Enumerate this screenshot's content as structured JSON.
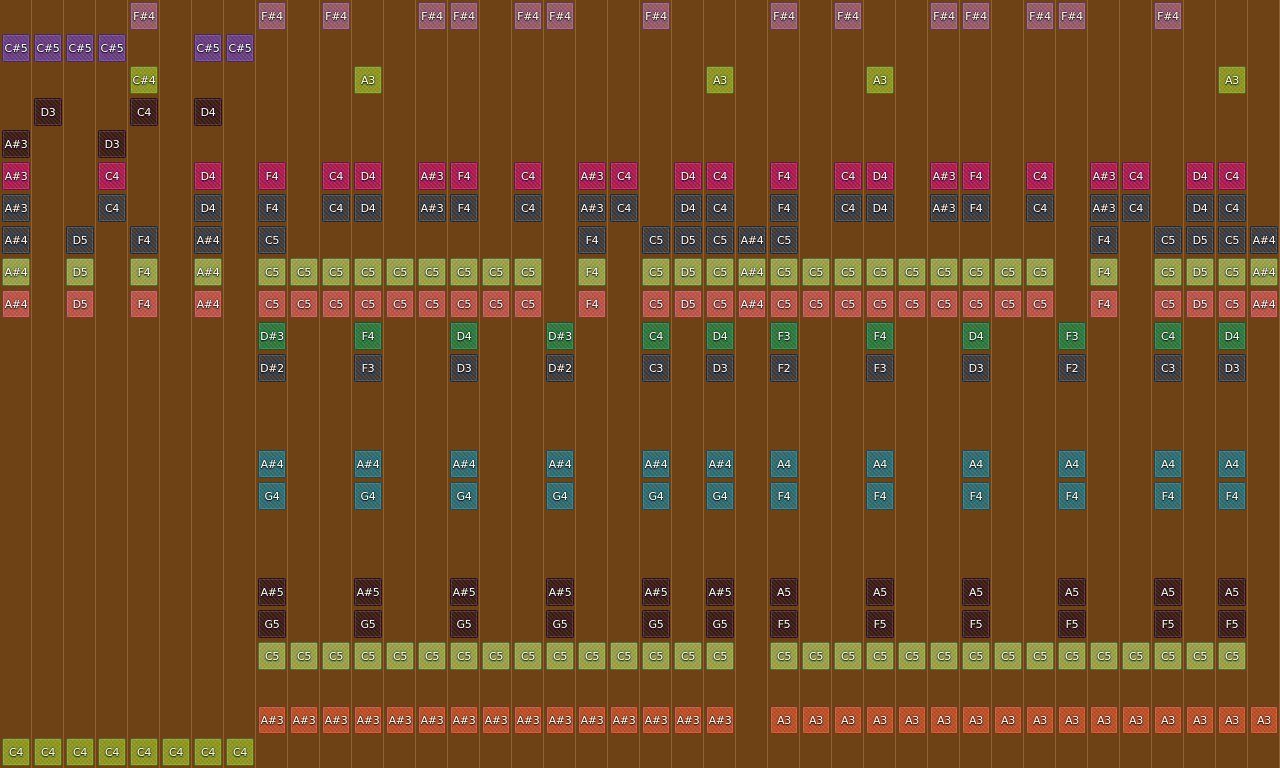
{
  "colors": {
    "background": "#6e4214",
    "pink": "#9a5a6a",
    "purple": "#6c3e86",
    "olive": "#8e9a1e",
    "darkbrown": "#3c1a16",
    "magenta": "#b01a52",
    "darkgray": "#3c3c3e",
    "lightgreen": "#9aa446",
    "salmon": "#c05446",
    "green": "#2c7a3c",
    "teal": "#2e6e72",
    "orange": "#c04e24"
  },
  "rows": [
    {
      "color": "pink",
      "notes": [
        [
          4,
          "F#4"
        ],
        [
          8,
          "F#4"
        ],
        [
          10,
          "F#4"
        ],
        [
          13,
          "F#4"
        ],
        [
          14,
          "F#4"
        ],
        [
          16,
          "F#4"
        ],
        [
          17,
          "F#4"
        ],
        [
          20,
          "F#4"
        ],
        [
          24,
          "F#4"
        ],
        [
          26,
          "F#4"
        ],
        [
          29,
          "F#4"
        ],
        [
          30,
          "F#4"
        ],
        [
          32,
          "F#4"
        ],
        [
          33,
          "F#4"
        ],
        [
          36,
          "F#4"
        ]
      ]
    },
    {
      "color": "purple",
      "notes": [
        [
          0,
          "C#5"
        ],
        [
          1,
          "C#5"
        ],
        [
          2,
          "C#5"
        ],
        [
          3,
          "C#5"
        ],
        [
          6,
          "C#5"
        ],
        [
          7,
          "C#5"
        ]
      ]
    },
    {
      "color": "olive",
      "notes": [
        [
          4,
          "C#4"
        ],
        [
          11,
          "A3"
        ],
        [
          22,
          "A3"
        ],
        [
          27,
          "A3"
        ],
        [
          38,
          "A3"
        ]
      ]
    },
    {
      "color": "darkbrown",
      "notes": [
        [
          1,
          "D3"
        ],
        [
          4,
          "C4"
        ],
        [
          6,
          "D4"
        ]
      ]
    },
    {
      "color": "darkbrown",
      "notes": [
        [
          0,
          "A#3"
        ],
        [
          3,
          "D3"
        ]
      ]
    },
    {
      "color": "magenta",
      "notes": [
        [
          0,
          "A#3"
        ],
        [
          3,
          "C4"
        ],
        [
          6,
          "D4"
        ],
        [
          8,
          "F4"
        ],
        [
          10,
          "C4"
        ],
        [
          11,
          "D4"
        ],
        [
          13,
          "A#3"
        ],
        [
          14,
          "F4"
        ],
        [
          16,
          "C4"
        ],
        [
          18,
          "A#3"
        ],
        [
          19,
          "C4"
        ],
        [
          21,
          "D4"
        ],
        [
          22,
          "C4"
        ],
        [
          24,
          "F4"
        ],
        [
          26,
          "C4"
        ],
        [
          27,
          "D4"
        ],
        [
          29,
          "A#3"
        ],
        [
          30,
          "F4"
        ],
        [
          32,
          "C4"
        ],
        [
          34,
          "A#3"
        ],
        [
          35,
          "C4"
        ],
        [
          37,
          "D4"
        ],
        [
          38,
          "C4"
        ]
      ]
    },
    {
      "color": "darkgray",
      "notes": [
        [
          0,
          "A#3"
        ],
        [
          3,
          "C4"
        ],
        [
          6,
          "D4"
        ],
        [
          8,
          "F4"
        ],
        [
          10,
          "C4"
        ],
        [
          11,
          "D4"
        ],
        [
          13,
          "A#3"
        ],
        [
          14,
          "F4"
        ],
        [
          16,
          "C4"
        ],
        [
          18,
          "A#3"
        ],
        [
          19,
          "C4"
        ],
        [
          21,
          "D4"
        ],
        [
          22,
          "C4"
        ],
        [
          24,
          "F4"
        ],
        [
          26,
          "C4"
        ],
        [
          27,
          "D4"
        ],
        [
          29,
          "A#3"
        ],
        [
          30,
          "F4"
        ],
        [
          32,
          "C4"
        ],
        [
          34,
          "A#3"
        ],
        [
          35,
          "C4"
        ],
        [
          37,
          "D4"
        ],
        [
          38,
          "C4"
        ]
      ]
    },
    {
      "color": "darkgray",
      "notes": [
        [
          0,
          "A#4"
        ],
        [
          2,
          "D5"
        ],
        [
          4,
          "F4"
        ],
        [
          6,
          "A#4"
        ],
        [
          8,
          "C5"
        ],
        [
          18,
          "F4"
        ],
        [
          20,
          "C5"
        ],
        [
          21,
          "D5"
        ],
        [
          22,
          "C5"
        ],
        [
          23,
          "A#4"
        ],
        [
          24,
          "C5"
        ],
        [
          34,
          "F4"
        ],
        [
          36,
          "C5"
        ],
        [
          37,
          "D5"
        ],
        [
          38,
          "C5"
        ],
        [
          39,
          "A#4"
        ]
      ]
    },
    {
      "color": "lightgreen",
      "notes": [
        [
          0,
          "A#4"
        ],
        [
          2,
          "D5"
        ],
        [
          4,
          "F4"
        ],
        [
          6,
          "A#4"
        ],
        [
          8,
          "C5"
        ],
        [
          9,
          "C5"
        ],
        [
          10,
          "C5"
        ],
        [
          11,
          "C5"
        ],
        [
          12,
          "C5"
        ],
        [
          13,
          "C5"
        ],
        [
          14,
          "C5"
        ],
        [
          15,
          "C5"
        ],
        [
          16,
          "C5"
        ],
        [
          18,
          "F4"
        ],
        [
          20,
          "C5"
        ],
        [
          21,
          "D5"
        ],
        [
          22,
          "C5"
        ],
        [
          23,
          "A#4"
        ],
        [
          24,
          "C5"
        ],
        [
          25,
          "C5"
        ],
        [
          26,
          "C5"
        ],
        [
          27,
          "C5"
        ],
        [
          28,
          "C5"
        ],
        [
          29,
          "C5"
        ],
        [
          30,
          "C5"
        ],
        [
          31,
          "C5"
        ],
        [
          32,
          "C5"
        ],
        [
          34,
          "F4"
        ],
        [
          36,
          "C5"
        ],
        [
          37,
          "D5"
        ],
        [
          38,
          "C5"
        ],
        [
          39,
          "A#4"
        ]
      ]
    },
    {
      "color": "salmon",
      "notes": [
        [
          0,
          "A#4"
        ],
        [
          2,
          "D5"
        ],
        [
          4,
          "F4"
        ],
        [
          6,
          "A#4"
        ],
        [
          8,
          "C5"
        ],
        [
          9,
          "C5"
        ],
        [
          10,
          "C5"
        ],
        [
          11,
          "C5"
        ],
        [
          12,
          "C5"
        ],
        [
          13,
          "C5"
        ],
        [
          14,
          "C5"
        ],
        [
          15,
          "C5"
        ],
        [
          16,
          "C5"
        ],
        [
          18,
          "F4"
        ],
        [
          20,
          "C5"
        ],
        [
          21,
          "D5"
        ],
        [
          22,
          "C5"
        ],
        [
          23,
          "A#4"
        ],
        [
          24,
          "C5"
        ],
        [
          25,
          "C5"
        ],
        [
          26,
          "C5"
        ],
        [
          27,
          "C5"
        ],
        [
          28,
          "C5"
        ],
        [
          29,
          "C5"
        ],
        [
          30,
          "C5"
        ],
        [
          31,
          "C5"
        ],
        [
          32,
          "C5"
        ],
        [
          34,
          "F4"
        ],
        [
          36,
          "C5"
        ],
        [
          37,
          "D5"
        ],
        [
          38,
          "C5"
        ],
        [
          39,
          "A#4"
        ]
      ]
    },
    {
      "color": "green",
      "notes": [
        [
          8,
          "D#3"
        ],
        [
          11,
          "F4"
        ],
        [
          14,
          "D4"
        ],
        [
          17,
          "D#3"
        ],
        [
          20,
          "C4"
        ],
        [
          22,
          "D4"
        ],
        [
          24,
          "F3"
        ],
        [
          27,
          "F4"
        ],
        [
          30,
          "D4"
        ],
        [
          33,
          "F3"
        ],
        [
          36,
          "C4"
        ],
        [
          38,
          "D4"
        ]
      ]
    },
    {
      "color": "darkgray",
      "notes": [
        [
          8,
          "D#2"
        ],
        [
          11,
          "F3"
        ],
        [
          14,
          "D3"
        ],
        [
          17,
          "D#2"
        ],
        [
          20,
          "C3"
        ],
        [
          22,
          "D3"
        ],
        [
          24,
          "F2"
        ],
        [
          27,
          "F3"
        ],
        [
          30,
          "D3"
        ],
        [
          33,
          "F2"
        ],
        [
          36,
          "C3"
        ],
        [
          38,
          "D3"
        ]
      ]
    },
    {
      "color": "teal",
      "notes": []
    },
    {
      "color": "teal",
      "notes": []
    },
    {
      "color": "teal",
      "notes": [
        [
          8,
          "A#4"
        ],
        [
          11,
          "A#4"
        ],
        [
          14,
          "A#4"
        ],
        [
          17,
          "A#4"
        ],
        [
          20,
          "A#4"
        ],
        [
          22,
          "A#4"
        ],
        [
          24,
          "A4"
        ],
        [
          27,
          "A4"
        ],
        [
          30,
          "A4"
        ],
        [
          33,
          "A4"
        ],
        [
          36,
          "A4"
        ],
        [
          38,
          "A4"
        ]
      ]
    },
    {
      "color": "teal",
      "notes": [
        [
          8,
          "G4"
        ],
        [
          11,
          "G4"
        ],
        [
          14,
          "G4"
        ],
        [
          17,
          "G4"
        ],
        [
          20,
          "G4"
        ],
        [
          22,
          "G4"
        ],
        [
          24,
          "F4"
        ],
        [
          27,
          "F4"
        ],
        [
          30,
          "F4"
        ],
        [
          33,
          "F4"
        ],
        [
          36,
          "F4"
        ],
        [
          38,
          "F4"
        ]
      ]
    },
    {
      "color": "teal",
      "notes": []
    },
    {
      "color": "teal",
      "notes": []
    },
    {
      "color": "darkbrown",
      "notes": [
        [
          8,
          "A#5"
        ],
        [
          11,
          "A#5"
        ],
        [
          14,
          "A#5"
        ],
        [
          17,
          "A#5"
        ],
        [
          20,
          "A#5"
        ],
        [
          22,
          "A#5"
        ],
        [
          24,
          "A5"
        ],
        [
          27,
          "A5"
        ],
        [
          30,
          "A5"
        ],
        [
          33,
          "A5"
        ],
        [
          36,
          "A5"
        ],
        [
          38,
          "A5"
        ]
      ]
    },
    {
      "color": "darkbrown",
      "notes": [
        [
          8,
          "G5"
        ],
        [
          11,
          "G5"
        ],
        [
          14,
          "G5"
        ],
        [
          17,
          "G5"
        ],
        [
          20,
          "G5"
        ],
        [
          22,
          "G5"
        ],
        [
          24,
          "F5"
        ],
        [
          27,
          "F5"
        ],
        [
          30,
          "F5"
        ],
        [
          33,
          "F5"
        ],
        [
          36,
          "F5"
        ],
        [
          38,
          "F5"
        ]
      ]
    },
    {
      "color": "lightgreen",
      "notes": [
        [
          8,
          "C5"
        ],
        [
          9,
          "C5"
        ],
        [
          10,
          "C5"
        ],
        [
          11,
          "C5"
        ],
        [
          12,
          "C5"
        ],
        [
          13,
          "C5"
        ],
        [
          14,
          "C5"
        ],
        [
          15,
          "C5"
        ],
        [
          16,
          "C5"
        ],
        [
          17,
          "C5"
        ],
        [
          18,
          "C5"
        ],
        [
          19,
          "C5"
        ],
        [
          20,
          "C5"
        ],
        [
          21,
          "C5"
        ],
        [
          22,
          "C5"
        ],
        [
          24,
          "C5"
        ],
        [
          25,
          "C5"
        ],
        [
          26,
          "C5"
        ],
        [
          27,
          "C5"
        ],
        [
          28,
          "C5"
        ],
        [
          29,
          "C5"
        ],
        [
          30,
          "C5"
        ],
        [
          31,
          "C5"
        ],
        [
          32,
          "C5"
        ],
        [
          33,
          "C5"
        ],
        [
          34,
          "C5"
        ],
        [
          35,
          "C5"
        ],
        [
          36,
          "C5"
        ],
        [
          37,
          "C5"
        ],
        [
          38,
          "C5"
        ]
      ]
    },
    {
      "color": "orange",
      "notes": []
    },
    {
      "color": "orange",
      "notes": [
        [
          8,
          "A#3"
        ],
        [
          9,
          "A#3"
        ],
        [
          10,
          "A#3"
        ],
        [
          11,
          "A#3"
        ],
        [
          12,
          "A#3"
        ],
        [
          13,
          "A#3"
        ],
        [
          14,
          "A#3"
        ],
        [
          15,
          "A#3"
        ],
        [
          16,
          "A#3"
        ],
        [
          17,
          "A#3"
        ],
        [
          18,
          "A#3"
        ],
        [
          19,
          "A#3"
        ],
        [
          20,
          "A#3"
        ],
        [
          21,
          "A#3"
        ],
        [
          22,
          "A#3"
        ],
        [
          24,
          "A3"
        ],
        [
          25,
          "A3"
        ],
        [
          26,
          "A3"
        ],
        [
          27,
          "A3"
        ],
        [
          28,
          "A3"
        ],
        [
          29,
          "A3"
        ],
        [
          30,
          "A3"
        ],
        [
          31,
          "A3"
        ],
        [
          32,
          "A3"
        ],
        [
          33,
          "A3"
        ],
        [
          34,
          "A3"
        ],
        [
          35,
          "A3"
        ],
        [
          36,
          "A3"
        ],
        [
          37,
          "A3"
        ],
        [
          38,
          "A3"
        ],
        [
          39,
          "A3"
        ]
      ]
    },
    {
      "color": "olive",
      "notes": [
        [
          0,
          "C4"
        ],
        [
          1,
          "C4"
        ],
        [
          2,
          "C4"
        ],
        [
          3,
          "C4"
        ],
        [
          4,
          "C4"
        ],
        [
          5,
          "C4"
        ],
        [
          6,
          "C4"
        ],
        [
          7,
          "C4"
        ]
      ]
    }
  ]
}
